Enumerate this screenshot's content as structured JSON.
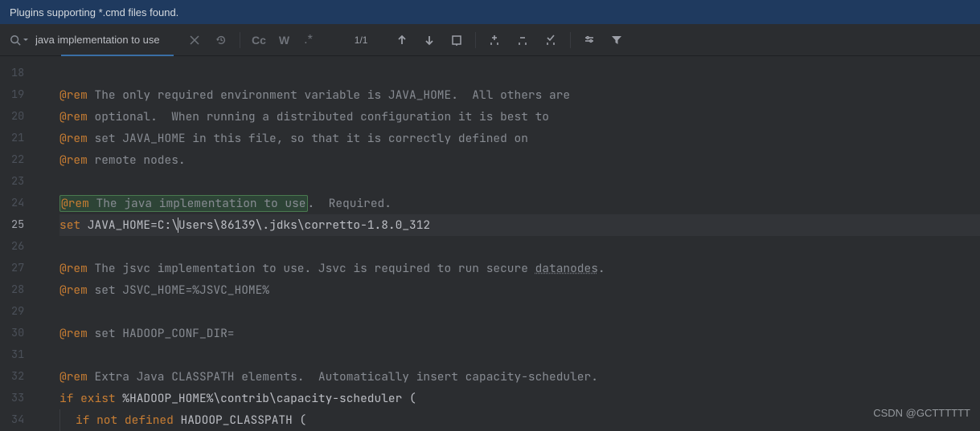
{
  "banner": {
    "text": "Plugins supporting *.cmd files found."
  },
  "search": {
    "value": "java implementation to use",
    "match_count": "1/1",
    "cc_label": "Cc",
    "w_label": "W",
    "asterisk_label": ".*"
  },
  "gutter": {
    "lines": [
      "18",
      "19",
      "20",
      "21",
      "22",
      "23",
      "24",
      "25",
      "26",
      "27",
      "28",
      "29",
      "30",
      "31",
      "32",
      "33",
      "34"
    ]
  },
  "code": {
    "l19": {
      "rem": "@rem",
      "text": " The only required environment variable is JAVA_HOME.  All others are"
    },
    "l20": {
      "rem": "@rem",
      "text": " optional.  When running a distributed configuration it is best to"
    },
    "l21": {
      "rem": "@rem",
      "text": " set JAVA_HOME in this file, so that it is correctly defined on"
    },
    "l22": {
      "rem": "@rem",
      "text": " remote nodes."
    },
    "l24": {
      "rem": "@rem",
      "match_pre": " The ",
      "match": "java implementation to use",
      "text_post": ".  Required."
    },
    "l25": {
      "set": "set",
      "text": " JAVA_HOME=C:\\",
      "caret_rest": "Users\\86139\\.jdks\\corretto-1.8.0_312"
    },
    "l27": {
      "rem": "@rem",
      "text_a": " The jsvc implementation to use. Jsvc is required to run secure ",
      "wavy": "datanodes",
      "text_b": "."
    },
    "l28": {
      "rem": "@rem",
      "text": " set JSVC_HOME=%JSVC_HOME%"
    },
    "l30": {
      "rem": "@rem",
      "text": " set HADOOP_CONF_DIR="
    },
    "l32": {
      "rem": "@rem",
      "text": " Extra Java CLASSPATH elements.  Automatically insert capacity-scheduler."
    },
    "l33": {
      "if": "if",
      "exist": "exist",
      "text": " %HADOOP_HOME%\\contrib\\capacity-scheduler ("
    },
    "l34": {
      "if": "if",
      "not": " not",
      "defined": " defined",
      "text": " HADOOP_CLASSPATH ("
    }
  },
  "watermark": "CSDN @GCTTTTTT"
}
